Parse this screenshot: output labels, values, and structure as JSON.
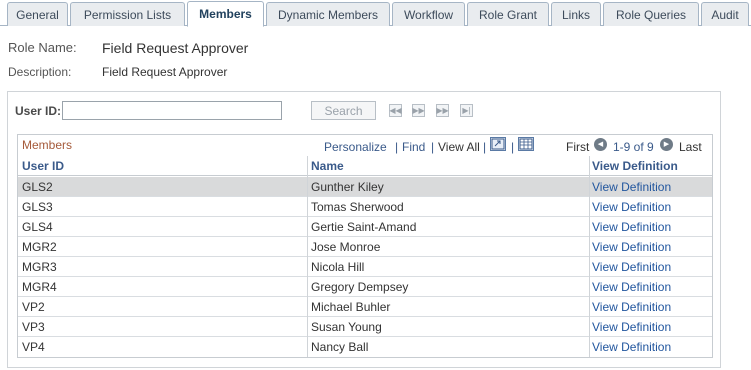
{
  "tabs": [
    {
      "label": "General",
      "active": false
    },
    {
      "label": "Permission Lists",
      "active": false
    },
    {
      "label": "Members",
      "active": true
    },
    {
      "label": "Dynamic Members",
      "active": false
    },
    {
      "label": "Workflow",
      "active": false
    },
    {
      "label": "Role Grant",
      "active": false
    },
    {
      "label": "Links",
      "active": false
    },
    {
      "label": "Role Queries",
      "active": false
    },
    {
      "label": "Audit",
      "active": false
    }
  ],
  "role": {
    "name_label": "Role Name:",
    "name_value": "Field Request Approver",
    "desc_label": "Description:",
    "desc_value": "Field Request Approver"
  },
  "search": {
    "user_id_label": "User ID:",
    "user_id_value": "",
    "button_label": "Search"
  },
  "grid": {
    "title": "Members",
    "personalize": "Personalize",
    "find": "Find",
    "view_all": "View All",
    "sep": "|",
    "first": "First",
    "range": "1-9 of 9",
    "last": "Last",
    "columns": [
      "User ID",
      "Name",
      "View Definition"
    ],
    "rows": [
      {
        "user_id": "GLS2",
        "name": "Gunther Kiley",
        "link": "View Definition"
      },
      {
        "user_id": "GLS3",
        "name": "Tomas Sherwood",
        "link": "View Definition"
      },
      {
        "user_id": "GLS4",
        "name": "Gertie Saint-Amand",
        "link": "View Definition"
      },
      {
        "user_id": "MGR2",
        "name": "Jose Monroe",
        "link": "View Definition"
      },
      {
        "user_id": "MGR3",
        "name": "Nicola Hill",
        "link": "View Definition"
      },
      {
        "user_id": "MGR4",
        "name": "Gregory Dempsey",
        "link": "View Definition"
      },
      {
        "user_id": "VP2",
        "name": "Michael Buhler",
        "link": "View Definition"
      },
      {
        "user_id": "VP3",
        "name": "Susan Young",
        "link": "View Definition"
      },
      {
        "user_id": "VP4",
        "name": "Nancy Ball",
        "link": "View Definition"
      }
    ]
  },
  "icons": {
    "zoom": "zoom-grid-icon",
    "download": "download-spreadsheet-icon",
    "prev": "previous-row-icon",
    "next": "next-row-icon",
    "nav_first": "first-page-icon",
    "nav_prev": "previous-page-icon",
    "nav_next": "next-page-icon",
    "nav_last": "last-page-icon"
  },
  "colors": {
    "link": "#22569e",
    "header_link": "#3a5a8a",
    "grid_title": "#a55a3a",
    "selected_row": "#d9dadb"
  }
}
